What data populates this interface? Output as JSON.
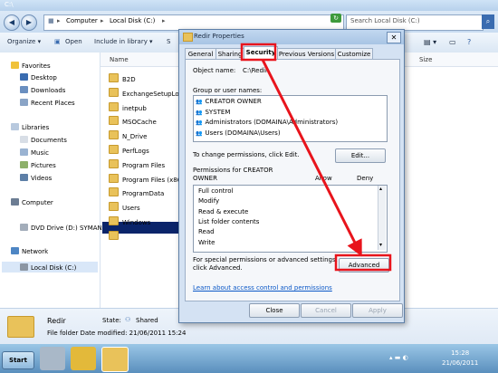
{
  "window": {
    "title": "C:\\"
  },
  "address": {
    "seg1": "Computer",
    "seg2": "Local Disk (C:)",
    "search_placeholder": "Search Local Disk (C:)"
  },
  "toolbar": {
    "organize": "Organize ▾",
    "open": "Open",
    "include": "Include in library ▾",
    "share": "S"
  },
  "nav": {
    "favorites": "Favorites",
    "desktop": "Desktop",
    "downloads": "Downloads",
    "recent": "Recent Places",
    "libraries": "Libraries",
    "documents": "Documents",
    "music": "Music",
    "pictures": "Pictures",
    "videos": "Videos",
    "computer": "Computer",
    "localdisk": "Local Disk (C:)",
    "dvd": "DVD Drive (D:) SYMAN",
    "network": "Network"
  },
  "columns": {
    "name": "Name",
    "size": "Size"
  },
  "files": [
    "B2D",
    "ExchangeSetupLog",
    "inetpub",
    "MSOCache",
    "N_Drive",
    "PerfLogs",
    "Program Files",
    "Program Files (x86",
    "ProgramData",
    "Users",
    "Windows",
    "Redir"
  ],
  "details": {
    "name": "Redir",
    "state_label": "State:",
    "state_value": "Shared",
    "modified": "File folder Date modified: 21/06/2011 15:24"
  },
  "taskbar": {
    "start": "Start",
    "time": "15:28",
    "date": "21/06/2011"
  },
  "dialog": {
    "title": "Redir Properties",
    "tabs": [
      "General",
      "Sharing",
      "Security",
      "Previous Versions",
      "Customize"
    ],
    "object_label": "Object name:",
    "object_value": "C:\\Redir",
    "group_label": "Group or user names:",
    "groups": [
      "CREATOR OWNER",
      "SYSTEM",
      "Administrators (DOMAINA\\Administrators)",
      "Users (DOMAINA\\Users)"
    ],
    "change_text": "To change permissions, click Edit.",
    "edit_button": "Edit...",
    "perm_label_1": "Permissions for CREATOR",
    "perm_label_2": "OWNER",
    "allow": "Allow",
    "deny": "Deny",
    "permissions": [
      "Full control",
      "Modify",
      "Read & execute",
      "List folder contents",
      "Read",
      "Write"
    ],
    "special_1": "For special permissions or advanced settings,",
    "special_2": "click Advanced.",
    "advanced_button": "Advanced",
    "link": "Learn about access control and permissions",
    "close_button": "Close",
    "cancel_button": "Cancel",
    "apply_button": "Apply"
  },
  "colors": {
    "annotation": "#e8141c",
    "selection": "#0a246a",
    "link": "#0b58c7"
  }
}
